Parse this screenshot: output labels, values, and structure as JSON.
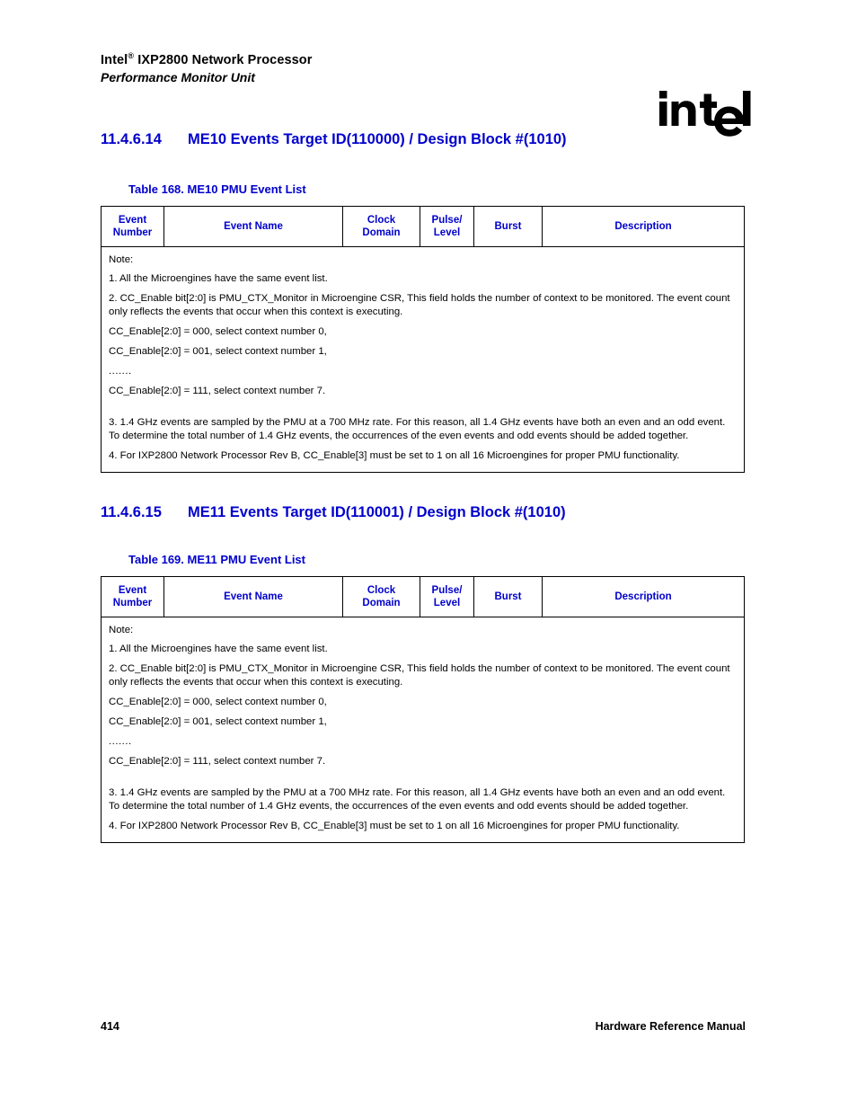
{
  "header": {
    "product": "IXP2800 Network Processor",
    "brand": "Intel",
    "registered_mark": "®",
    "subtitle": "Performance Monitor Unit",
    "logo_name": "intel-logo",
    "logo_text": "intel"
  },
  "sections": [
    {
      "number": "11.4.6.14",
      "title": "ME10 Events Target ID(110000) / Design Block #(1010)",
      "caption": "Table 168. ME10 PMU Event List"
    },
    {
      "number": "11.4.6.15",
      "title": "ME11 Events Target ID(110001) / Design Block #(1010)",
      "caption": "Table 169. ME11 PMU Event List"
    }
  ],
  "table": {
    "columns": [
      "Event Number",
      "Event Name",
      "Clock Domain",
      "Pulse/ Level",
      "Burst",
      "Description"
    ],
    "columns_split": [
      [
        "Event",
        "Number"
      ],
      [
        "Event Name"
      ],
      [
        "Clock",
        "Domain"
      ],
      [
        "Pulse/",
        "Level"
      ],
      [
        "Burst"
      ],
      [
        "Description"
      ]
    ],
    "notes": [
      "Note:",
      "1. All the Microengines have the same event list.",
      "2. CC_Enable bit[2:0] is PMU_CTX_Monitor in Microengine CSR, This field holds the number of context to be monitored. The event count only reflects the events that occur when this context is executing.",
      "CC_Enable[2:0] = 000, select context number 0,",
      "CC_Enable[2:0] = 001, select context number 1,",
      ".......",
      "CC_Enable[2:0] = 111, select context number 7.",
      "3. 1.4 GHz events are sampled by the PMU at a 700 MHz rate. For this reason, all 1.4 GHz events have both an even and an odd event. To determine the total number of 1.4 GHz events, the occurrences of the even events and odd events should be added together.",
      "4. For IXP2800 Network Processor Rev B, CC_Enable[3] must be set to 1 on all 16 Microengines for proper PMU functionality."
    ]
  },
  "footer": {
    "page_number": "414",
    "manual_title": "Hardware Reference Manual"
  },
  "colors": {
    "heading_blue": "#0000cd",
    "text_black": "#000000",
    "background": "#ffffff"
  }
}
